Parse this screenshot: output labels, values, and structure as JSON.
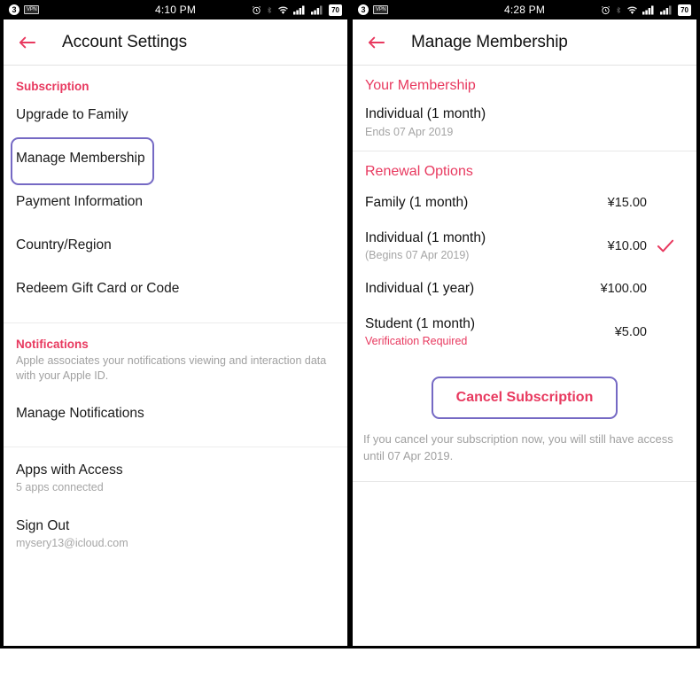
{
  "left_panel": {
    "status_bar": {
      "notification_count": "3",
      "vpn_label": "VPN",
      "time": "4:10 PM",
      "battery_level": "70"
    },
    "nav": {
      "title": "Account Settings",
      "back_icon": "back-arrow-icon"
    },
    "sections": [
      {
        "header": "Subscription",
        "items": [
          {
            "title": "Upgrade to Family",
            "sub": ""
          },
          {
            "title": "Manage Membership",
            "sub": "",
            "highlighted": true
          },
          {
            "title": "Payment Information",
            "sub": ""
          },
          {
            "title": "Country/Region",
            "sub": ""
          },
          {
            "title": "Redeem Gift Card or Code",
            "sub": ""
          }
        ]
      },
      {
        "header": "Notifications",
        "note": "Apple associates your notifications viewing and interaction data with your Apple ID.",
        "items": [
          {
            "title": "Manage Notifications",
            "sub": ""
          }
        ]
      },
      {
        "header": "",
        "items": [
          {
            "title": "Apps with Access",
            "sub": "5 apps connected"
          },
          {
            "title": "Sign Out",
            "sub": "mysery13@icloud.com"
          }
        ]
      }
    ]
  },
  "right_panel": {
    "status_bar": {
      "notification_count": "3",
      "vpn_label": "VPN",
      "time": "4:28 PM",
      "battery_level": "70"
    },
    "nav": {
      "title": "Manage Membership",
      "back_icon": "back-arrow-icon"
    },
    "your_membership": {
      "header": "Your Membership",
      "plan": "Individual (1 month)",
      "ends": "Ends 07 Apr 2019"
    },
    "renewal": {
      "header": "Renewal Options",
      "options": [
        {
          "name": "Family (1 month)",
          "note": "",
          "note_warn": false,
          "price": "¥15.00",
          "selected": false
        },
        {
          "name": "Individual (1 month)",
          "note": "(Begins 07 Apr 2019)",
          "note_warn": false,
          "price": "¥10.00",
          "selected": true
        },
        {
          "name": "Individual  (1 year)",
          "note": "",
          "note_warn": false,
          "price": "¥100.00",
          "selected": false
        },
        {
          "name": "Student (1 month)",
          "note": "Verification Required",
          "note_warn": true,
          "price": "¥5.00",
          "selected": false
        }
      ]
    },
    "cancel": {
      "button_label": "Cancel Subscription",
      "note": "If you cancel your subscription now, you will still have access until 07 Apr 2019."
    }
  },
  "colors": {
    "accent_pink": "#e8395f",
    "highlight_purple": "#7569c4",
    "muted_gray": "#a5a5a5"
  }
}
